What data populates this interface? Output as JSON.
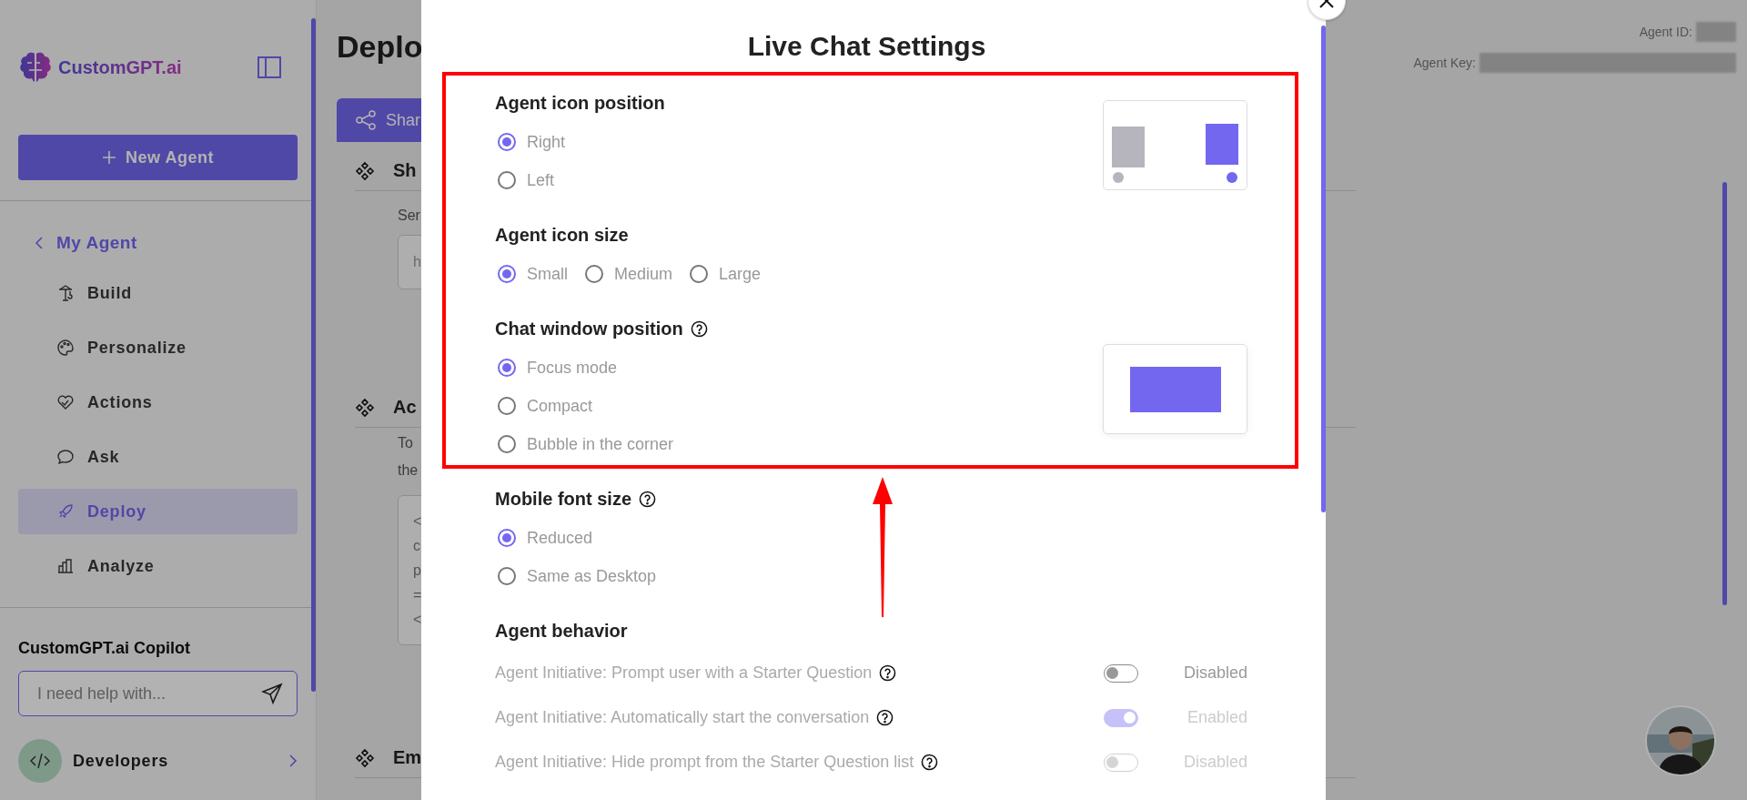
{
  "sidebar": {
    "logo_text": "CustomGPT.ai",
    "new_agent_button": "New Agent",
    "back_link": "My Agent",
    "items": [
      {
        "label": "Build",
        "selected": false
      },
      {
        "label": "Personalize",
        "selected": false
      },
      {
        "label": "Actions",
        "selected": false
      },
      {
        "label": "Ask",
        "selected": false
      },
      {
        "label": "Deploy",
        "selected": true
      },
      {
        "label": "Analyze",
        "selected": false
      }
    ],
    "copilot": {
      "title": "CustomGPT.ai Copilot",
      "placeholder": "I need help with..."
    },
    "developers": "Developers"
  },
  "main": {
    "title": "Deplo",
    "tab": "Shar",
    "agent_id_label": "Agent ID:",
    "agent_key_label": "Agent Key:",
    "sections": [
      {
        "heading": "Sh",
        "text": [
          "Ser"
        ],
        "field_value": "h"
      },
      {
        "heading": "Ac",
        "text": [
          "To",
          "the"
        ],
        "code": [
          "<",
          "c",
          "p",
          "=",
          "<"
        ]
      },
      {
        "heading": "Em"
      }
    ]
  },
  "modal": {
    "title": "Live Chat Settings",
    "groups": [
      {
        "title": "Agent icon position",
        "help": false,
        "inline": false,
        "kind": "icon-position",
        "options": [
          {
            "label": "Right",
            "selected": true
          },
          {
            "label": "Left",
            "selected": false
          }
        ]
      },
      {
        "title": "Agent icon size",
        "help": false,
        "inline": true,
        "options": [
          {
            "label": "Small",
            "selected": true
          },
          {
            "label": "Medium",
            "selected": false
          },
          {
            "label": "Large",
            "selected": false
          }
        ]
      },
      {
        "title": "Chat window position",
        "help": true,
        "inline": false,
        "kind": "window-position",
        "options": [
          {
            "label": "Focus mode",
            "selected": true
          },
          {
            "label": "Compact",
            "selected": false
          },
          {
            "label": "Bubble in the corner",
            "selected": false
          }
        ]
      },
      {
        "title": "Mobile font size",
        "help": true,
        "inline": false,
        "options": [
          {
            "label": "Reduced",
            "selected": true
          },
          {
            "label": "Same as Desktop",
            "selected": false
          }
        ]
      }
    ],
    "behavior": {
      "title": "Agent behavior",
      "rows": [
        {
          "label": "Agent Initiative: Prompt user with a Starter Question",
          "on": false,
          "disabled": false,
          "status": "Disabled"
        },
        {
          "label": "Agent Initiative: Automatically start the conversation",
          "on": true,
          "disabled": true,
          "status": "Enabled"
        },
        {
          "label": "Agent Initiative: Hide prompt from the Starter Question list",
          "on": false,
          "disabled": true,
          "status": "Disabled"
        }
      ]
    }
  }
}
